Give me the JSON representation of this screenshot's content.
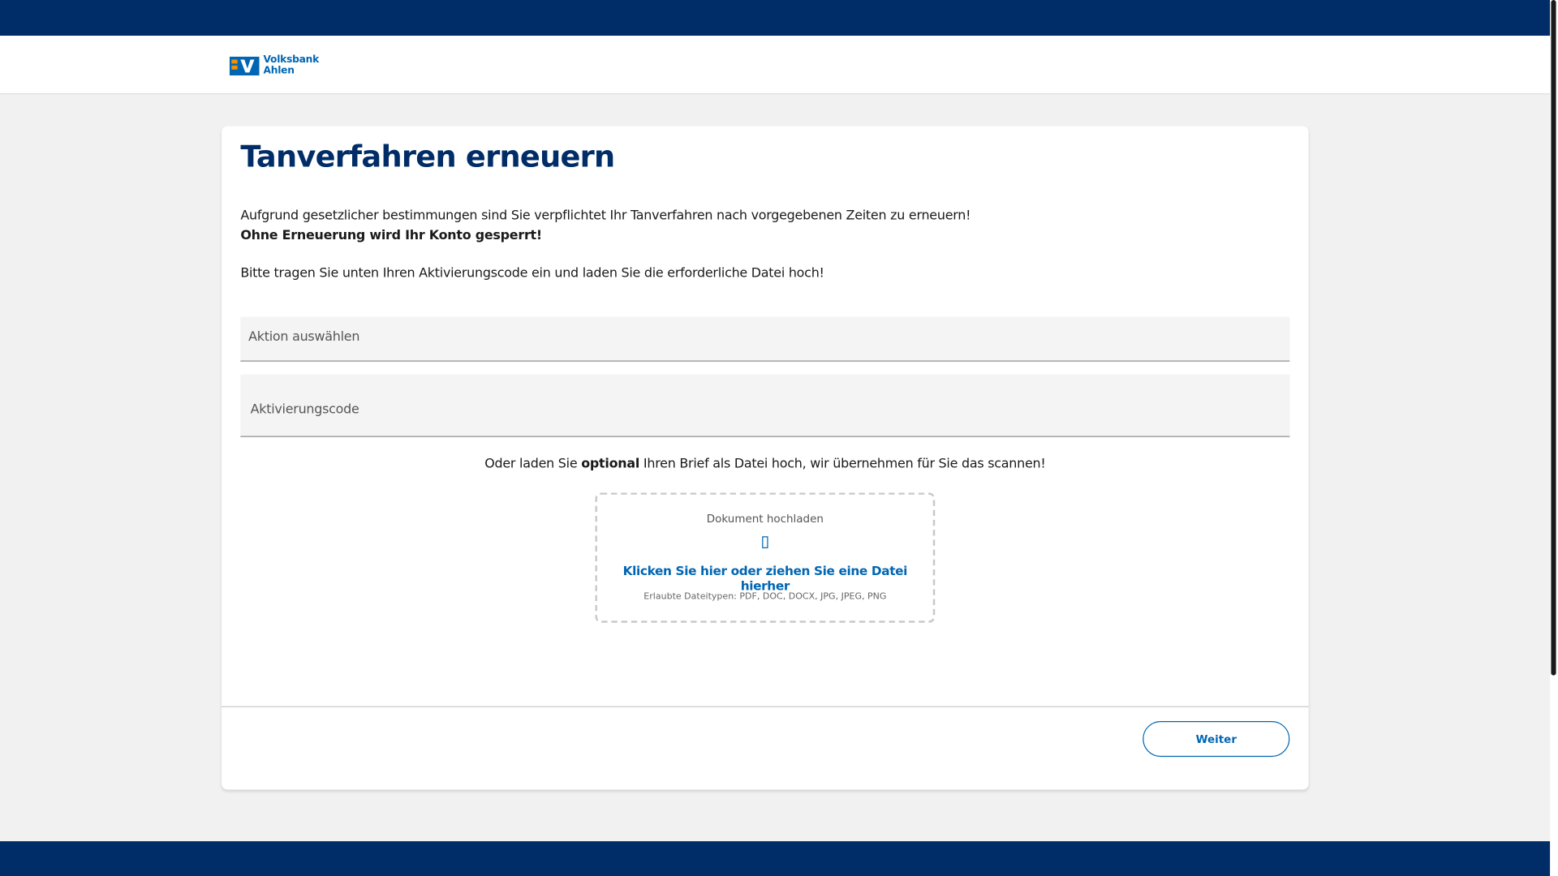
{
  "brand": {
    "name_line1": "Volksbank",
    "name_line2": "Ahlen",
    "logo_icon": "volksbank-logo-icon",
    "colors": {
      "navy": "#002d67",
      "blue": "#0066b3",
      "orange": "#f39200"
    }
  },
  "card": {
    "title": "Tanverfahren erneuern",
    "intro_line1": "Aufgrund gesetzlicher bestimmungen sind Sie verpflichtet Ihr Tanverfahren nach vorgegebenen Zeiten zu erneuern!",
    "intro_line2": "Ohne Erneuerung wird Ihr Konto gesperrt!",
    "intro_line3": "Bitte tragen Sie unten Ihren Aktivierungscode ein und laden Sie die erforderliche Datei hoch!"
  },
  "form": {
    "action_select_label": "Aktion auswählen",
    "activation_code_label": "Aktivierungscode"
  },
  "upload": {
    "prefix": "Oder laden Sie ",
    "emphasis": "optional",
    "suffix": " Ihren Brief als Datei hoch, wir übernehmen für Sie das scannen!",
    "dropzone_title": "Dokument hochladen",
    "dropzone_icon": "document-icon",
    "dropzone_link": "Klicken Sie hier oder ziehen Sie eine Datei hierher",
    "dropzone_hint": "Erlaubte Dateitypen: PDF, DOC, DOCX, JPG, JPEG, PNG"
  },
  "footer": {
    "next_button": "Weiter"
  }
}
